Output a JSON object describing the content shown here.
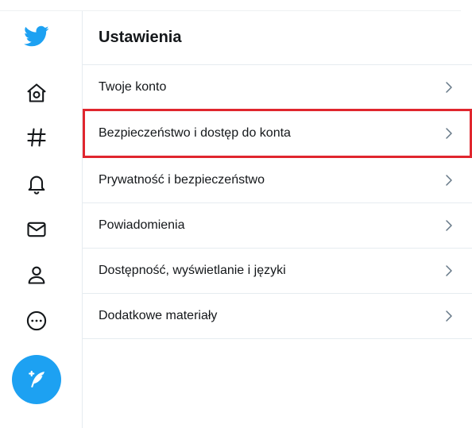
{
  "header": {
    "title": "Ustawienia"
  },
  "sidebar": {
    "items": [
      {
        "name": "twitter-logo-icon"
      },
      {
        "name": "home-icon"
      },
      {
        "name": "explore-hashtag-icon"
      },
      {
        "name": "notifications-bell-icon"
      },
      {
        "name": "messages-envelope-icon"
      },
      {
        "name": "profile-person-icon"
      },
      {
        "name": "more-options-icon"
      }
    ],
    "compose": {
      "name": "compose-tweet-icon"
    }
  },
  "settings": {
    "items": [
      {
        "label": "Twoje konto"
      },
      {
        "label": "Bezpieczeństwo i dostęp do konta",
        "highlighted": true
      },
      {
        "label": "Prywatność i bezpieczeństwo"
      },
      {
        "label": "Powiadomienia"
      },
      {
        "label": "Dostępność, wyświetlanie i języki"
      },
      {
        "label": "Dodatkowe materiały"
      }
    ]
  },
  "colors": {
    "accent": "#1da1f2",
    "highlight_border": "#e0262e",
    "text": "#14171a",
    "divider": "#e6ecf0"
  }
}
